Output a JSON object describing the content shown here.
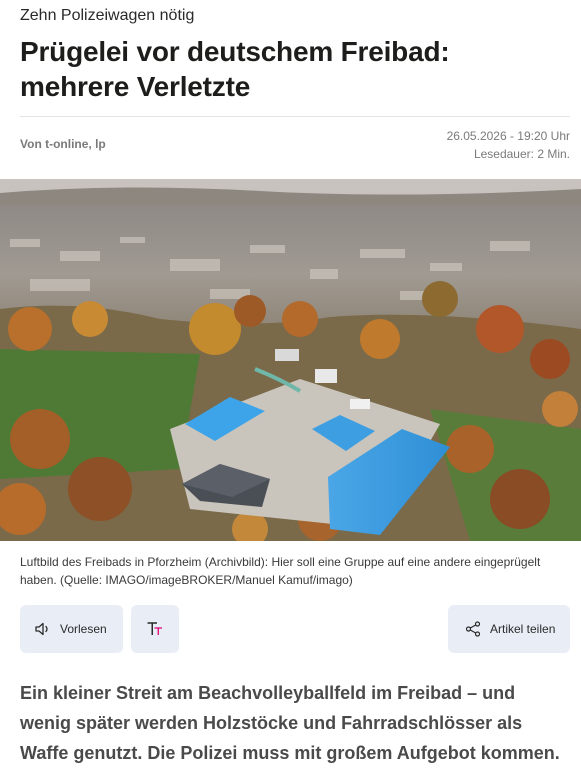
{
  "article": {
    "kicker": "Zehn Polizeiwagen nötig",
    "headline": "Prügelei vor deutschem Freibad: mehrere Verletzte",
    "author": "Von t-online, lp",
    "date": "26.05.2026 - 19:20 Uhr",
    "reading_time": "Lesedauer: 2 Min.",
    "caption": "Luftbild des Freibads in Pforzheim (Archivbild): Hier soll eine Gruppe auf eine andere eingeprügelt haben. (Quelle: IMAGO/imageBROKER/Manuel Kamuf/imago)",
    "lead": "Ein kleiner Streit am Beachvolleyballfeld im Freibad – und wenig später werden Holzstöcke und Fahrradschlösser als Waffe genutzt. Die Polizei muss mit großem Aufgebot kommen."
  },
  "toolbar": {
    "read_aloud_label": "Vorlesen",
    "read_aloud_icon": "speaker-icon",
    "text_size_icon": "text-size-icon",
    "share_label": "Artikel teilen",
    "share_icon": "share-icon"
  },
  "colors": {
    "accent": "#e20074",
    "button_bg": "#e9eef6",
    "pool_blue": "#2f8fd6"
  }
}
